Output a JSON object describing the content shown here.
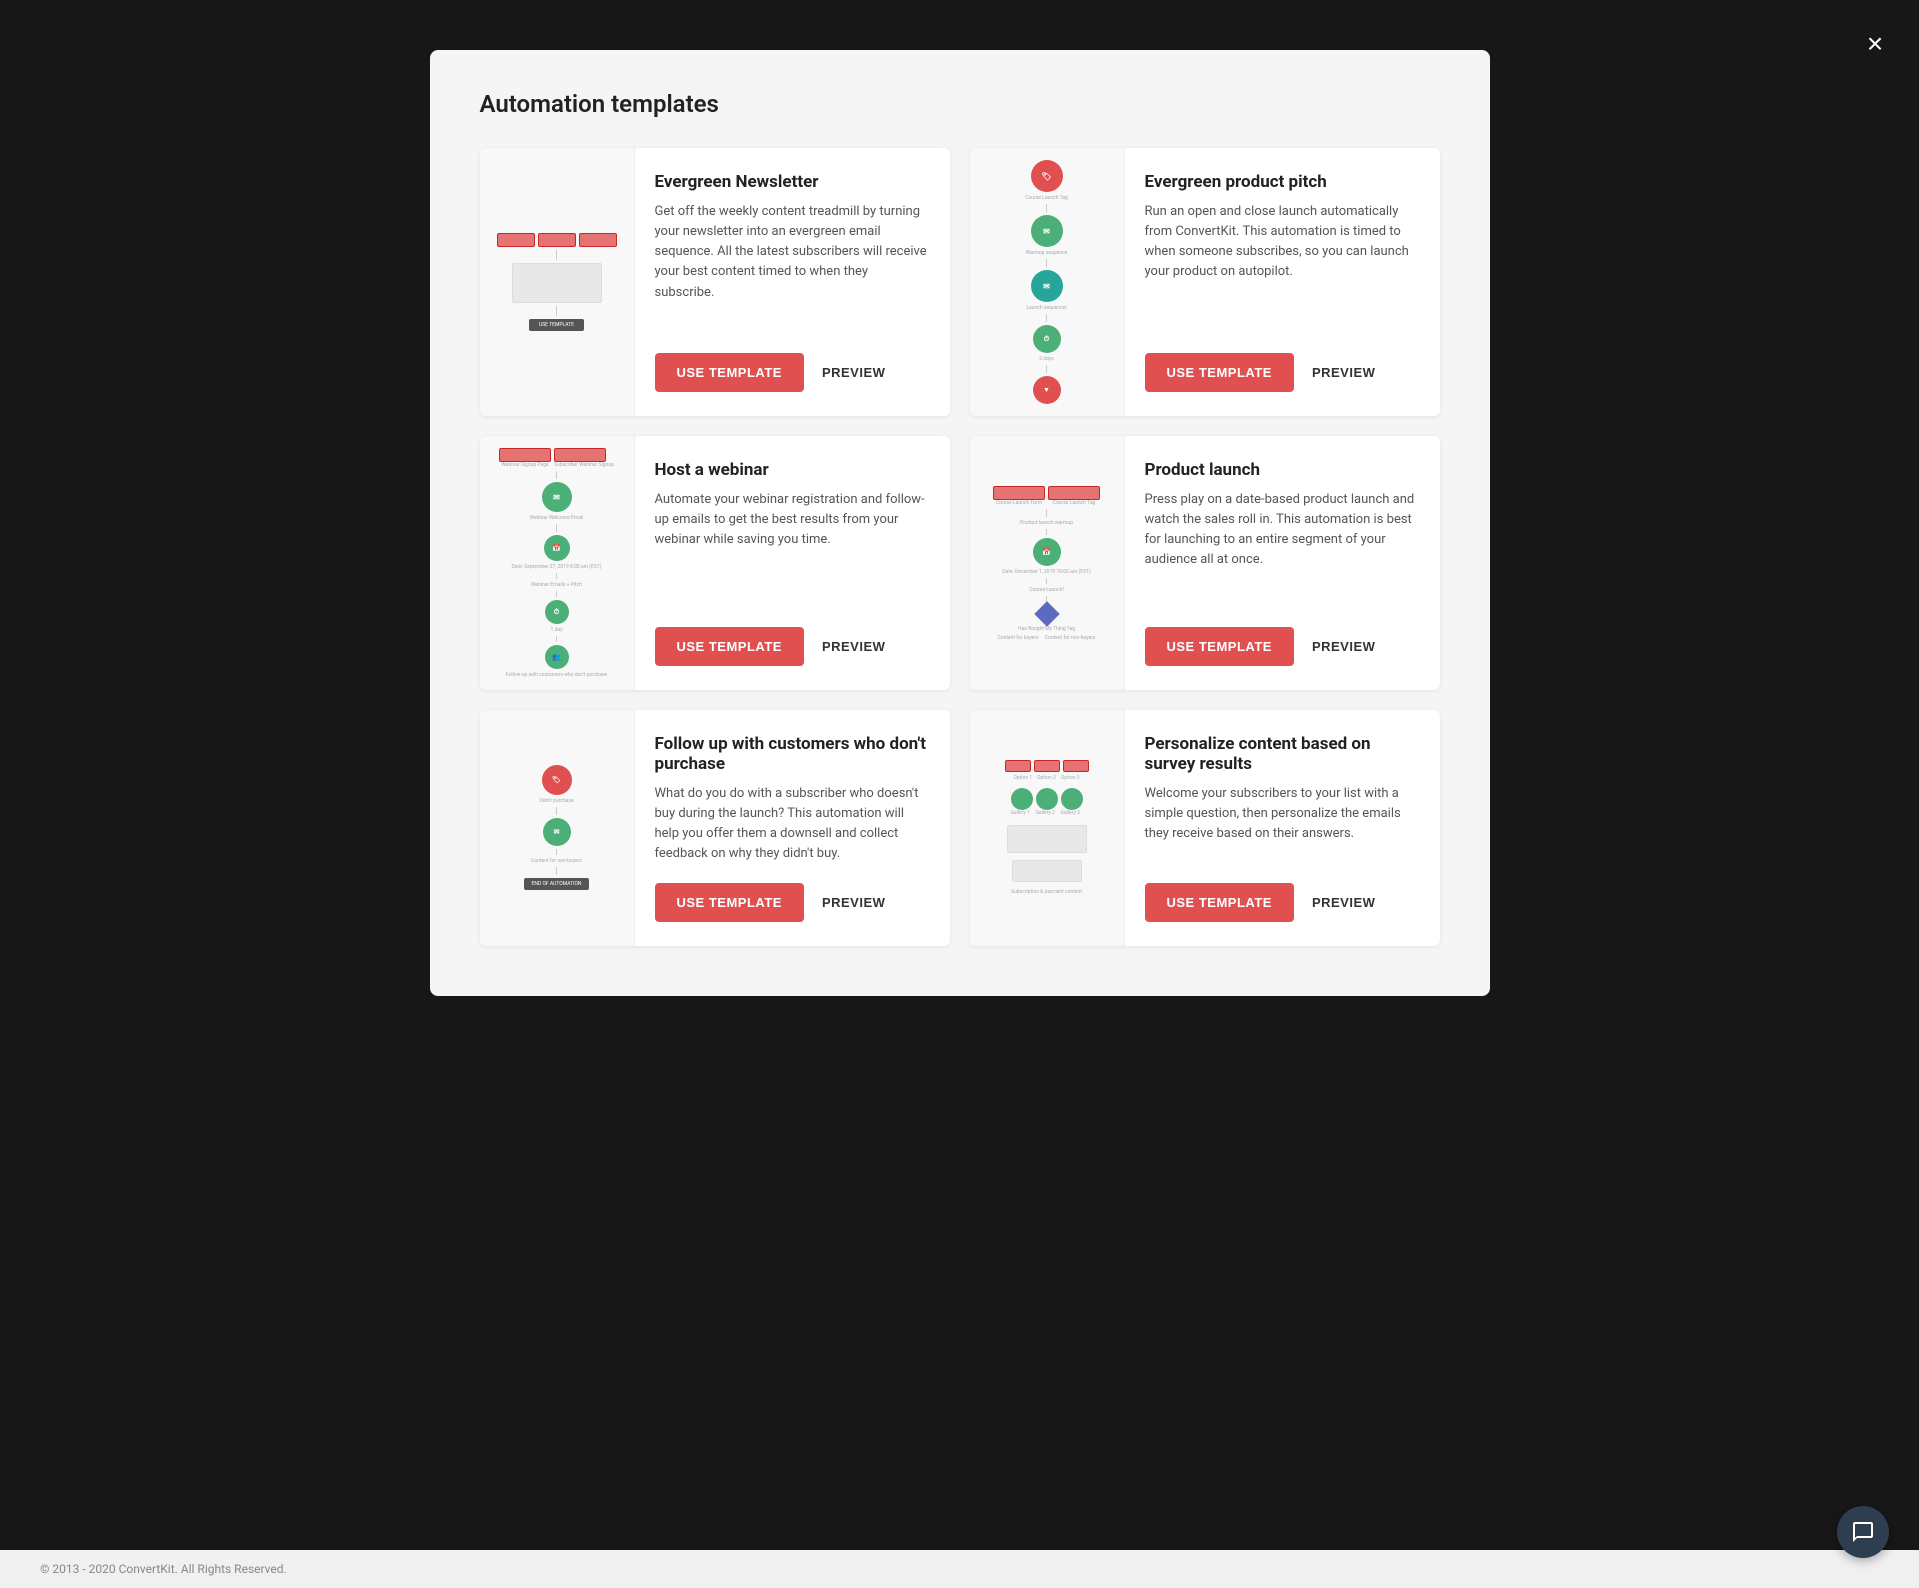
{
  "modal": {
    "title": "Automation templates",
    "close_label": "×"
  },
  "footer": {
    "copyright": "© 2013 - 2020 ConvertKit. All Rights Reserved."
  },
  "chat_icon": "💬",
  "templates": [
    {
      "id": "evergreen-newsletter",
      "title": "Evergreen Newsletter",
      "description": "Get off the weekly content treadmill by turning your newsletter into an evergreen email sequence. All the latest subscribers will receive your best content timed to when they subscribe.",
      "use_template_label": "USE TEMPLATE",
      "preview_label": "PREVIEW"
    },
    {
      "id": "evergreen-product-pitch",
      "title": "Evergreen product pitch",
      "description": "Run an open and close launch automatically from ConvertKit. This automation is timed to when someone subscribes, so you can launch your product on autopilot.",
      "use_template_label": "USE TEMPLATE",
      "preview_label": "PREVIEW"
    },
    {
      "id": "host-a-webinar",
      "title": "Host a webinar",
      "description": "Automate your webinar registration and follow-up emails to get the best results from your webinar while saving you time.",
      "use_template_label": "USE TEMPLATE",
      "preview_label": "PREVIEW"
    },
    {
      "id": "product-launch",
      "title": "Product launch",
      "description": "Press play on a date-based product launch and watch the sales roll in. This automation is best for launching to an entire segment of your audience all at once.",
      "use_template_label": "USE TEMPLATE",
      "preview_label": "PREVIEW"
    },
    {
      "id": "follow-up-no-purchase",
      "title": "Follow up with customers who don't purchase",
      "description": "What do you do with a subscriber who doesn't buy during the launch? This automation will help you offer them a downsell and collect feedback on why they didn't buy.",
      "use_template_label": "USE TEMPLATE",
      "preview_label": "PREVIEW"
    },
    {
      "id": "personalize-survey",
      "title": "Personalize content based on survey results",
      "description": "Welcome your subscribers to your list with a simple question, then personalize the emails they receive based on their answers.",
      "use_template_label": "USE TEMPLATE",
      "preview_label": "PREVIEW"
    }
  ]
}
